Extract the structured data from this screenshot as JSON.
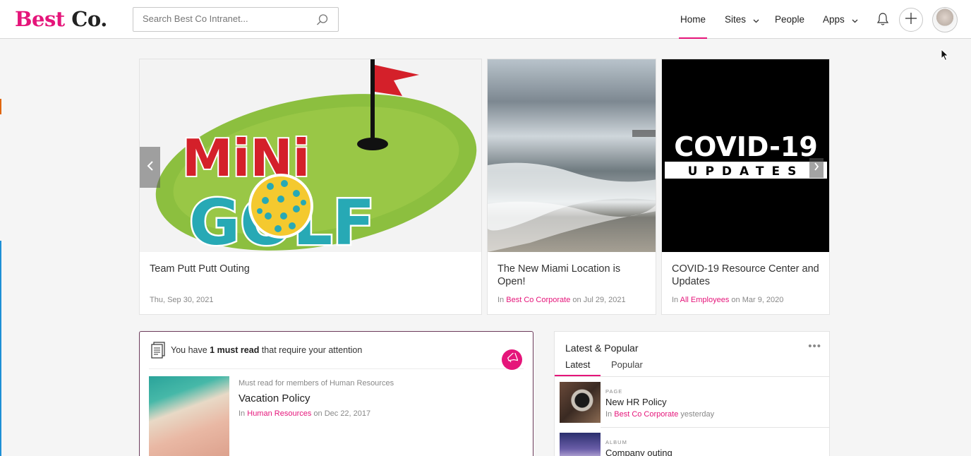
{
  "header": {
    "logo_best": "Best",
    "logo_co": "Co.",
    "search_placeholder": "Search Best Co Intranet...",
    "nav": [
      {
        "label": "Home",
        "active": true
      },
      {
        "label": "Sites",
        "has_dropdown": true
      },
      {
        "label": "People"
      },
      {
        "label": "Apps",
        "has_dropdown": true
      }
    ],
    "icons": [
      "bell-icon",
      "plus-icon",
      "avatar"
    ]
  },
  "carousel": [
    {
      "title": "Team Putt Putt Outing",
      "meta_date": "Thu, Sep 30, 2021",
      "image": "mini-golf"
    },
    {
      "title": "The New Miami Location is Open!",
      "meta_prefix": "In",
      "meta_link": "Best Co Corporate",
      "meta_on": "on Jul 29, 2021",
      "image": "beach"
    },
    {
      "title": "COVID-19 Resource Center and Updates",
      "meta_prefix": "In",
      "meta_link": "All Employees",
      "meta_on": "on Mar 9, 2020",
      "image": "covid"
    }
  ],
  "images": {
    "golf_word_1": "MiNi",
    "golf_word_2": "GOLF",
    "covid_line_1": "COVID-19",
    "covid_line_2": "UPDATES"
  },
  "must_read": {
    "text_before": "You have",
    "count_text": "1 must read",
    "text_after": "that require your attention",
    "item": {
      "subtitle": "Must read for members of Human Resources",
      "title": "Vacation Policy",
      "meta_prefix": "In",
      "meta_link": "Human Resources",
      "meta_on": "on Dec 22, 2017"
    }
  },
  "latest_popular": {
    "title": "Latest & Popular",
    "more": "•••",
    "tabs": [
      "Latest",
      "Popular"
    ],
    "items": [
      {
        "kind": "PAGE",
        "name": "New HR Policy",
        "meta_prefix": "In",
        "meta_link": "Best Co Corporate",
        "meta_on": "yesterday"
      },
      {
        "kind": "ALBUM",
        "name": "Company outing"
      }
    ]
  },
  "colors": {
    "accent": "#e5157a",
    "golf_green": "#8cbf3f",
    "golf_red": "#d4202a",
    "golf_teal": "#27a9b5",
    "golf_yellow": "#f4c92f"
  }
}
